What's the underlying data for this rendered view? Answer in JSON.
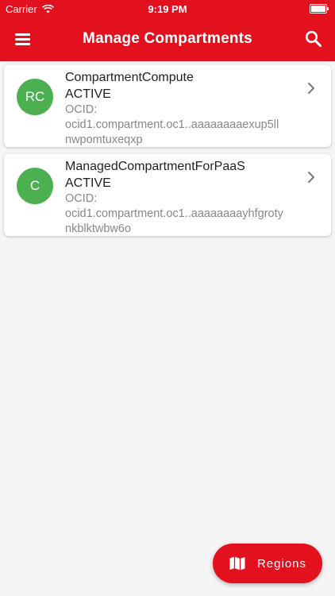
{
  "status_bar": {
    "carrier": "Carrier",
    "time": "9:19 PM"
  },
  "header": {
    "title": "Manage Compartments",
    "menu_icon": "hamburger-menu-icon",
    "search_icon": "search-icon"
  },
  "compartments": [
    {
      "initials": "RC",
      "name": "CompartmentCompute",
      "state": "ACTIVE",
      "ocid_label": "OCID:",
      "ocid": "ocid1.compartment.oc1..aaaaaaaaexup5llnwpomtuxeqxp"
    },
    {
      "initials": "C",
      "name": "ManagedCompartmentForPaaS",
      "state": "ACTIVE",
      "ocid_label": "OCID:",
      "ocid": "ocid1.compartment.oc1..aaaaaaaayhfgrotynkblktwbw6o"
    }
  ],
  "fab": {
    "label": "Regions",
    "icon": "map-icon"
  },
  "colors": {
    "brand_red": "#e3101d",
    "avatar_green": "#4caf50",
    "background": "#f5f5f5"
  }
}
